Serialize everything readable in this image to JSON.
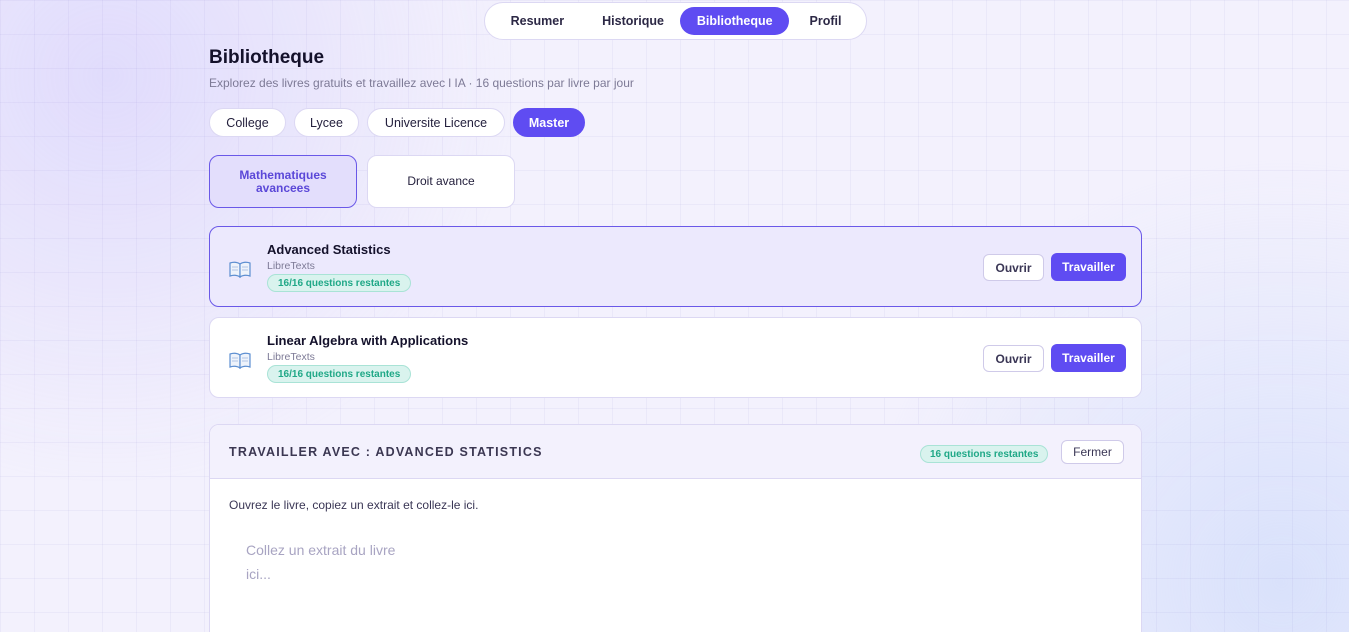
{
  "nav": {
    "items": [
      {
        "label": "Resumer",
        "active": false
      },
      {
        "label": "Historique",
        "active": false
      },
      {
        "label": "Bibliotheque",
        "active": true
      },
      {
        "label": "Profil",
        "active": false
      }
    ]
  },
  "header": {
    "title": "Bibliotheque",
    "subtitle": "Explorez des livres gratuits et travaillez avec l IA · 16 questions par livre par jour"
  },
  "levels": [
    {
      "label": "College",
      "active": false
    },
    {
      "label": "Lycee",
      "active": false
    },
    {
      "label": "Universite Licence",
      "active": false
    },
    {
      "label": "Master",
      "active": true
    }
  ],
  "subjects": [
    {
      "label": "Mathematiques avancees",
      "active": true
    },
    {
      "label": "Droit avance",
      "active": false
    }
  ],
  "books": [
    {
      "title": "Advanced Statistics",
      "source": "LibreTexts",
      "badge": "16/16 questions restantes",
      "open_label": "Ouvrir",
      "work_label": "Travailler",
      "active": true
    },
    {
      "title": "Linear Algebra with Applications",
      "source": "LibreTexts",
      "badge": "16/16 questions restantes",
      "open_label": "Ouvrir",
      "work_label": "Travailler",
      "active": false
    }
  ],
  "panel": {
    "title": "TRAVAILLER AVEC : ADVANCED STATISTICS",
    "badge": "16 questions restantes",
    "close_label": "Fermer",
    "instruction": "Ouvrez le livre, copiez un extrait et collez-le ici.",
    "excerpt_value": "",
    "excerpt_placeholder": "Collez un extrait du livre ici..."
  },
  "colors": {
    "accent": "#5f4cf2",
    "success": "#20a887",
    "background": "#f3f1fd"
  }
}
